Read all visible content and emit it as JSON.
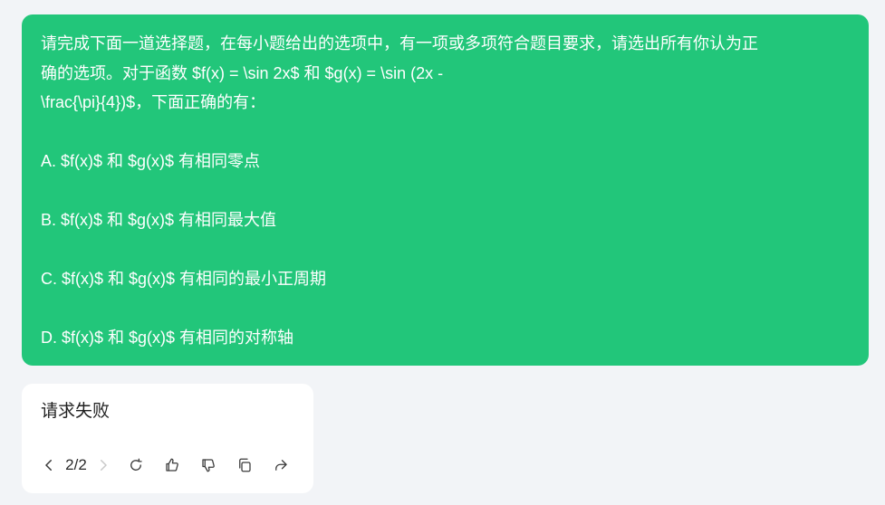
{
  "question": {
    "lines": [
      "请完成下面一道选择题，在每小题给出的选项中，有一项或多项符合题目要求，请选出所有你认为正",
      "确的选项。对于函数 $f(x) = \\sin 2x$ 和 $g(x) = \\sin (2x -",
      "\\frac{\\pi}{4})$，下面正确的有：",
      "",
      "A. $f(x)$ 和 $g(x)$ 有相同零点",
      "",
      "B. $f(x)$ 和 $g(x)$ 有相同最大值",
      "",
      "C. $f(x)$ 和 $g(x)$ 有相同的最小正周期",
      "",
      "D. $f(x)$ 和 $g(x)$ 有相同的对称轴"
    ]
  },
  "answer": {
    "text": "请求失败",
    "pager": "2/2",
    "icons": [
      "chevron-left-icon",
      "chevron-right-icon",
      "regenerate-icon",
      "thumbs-up-icon",
      "thumbs-down-icon",
      "copy-icon",
      "share-icon"
    ]
  },
  "colors": {
    "bubble": "#22c67a",
    "background": "#f2f4f7",
    "card": "#ffffff"
  }
}
